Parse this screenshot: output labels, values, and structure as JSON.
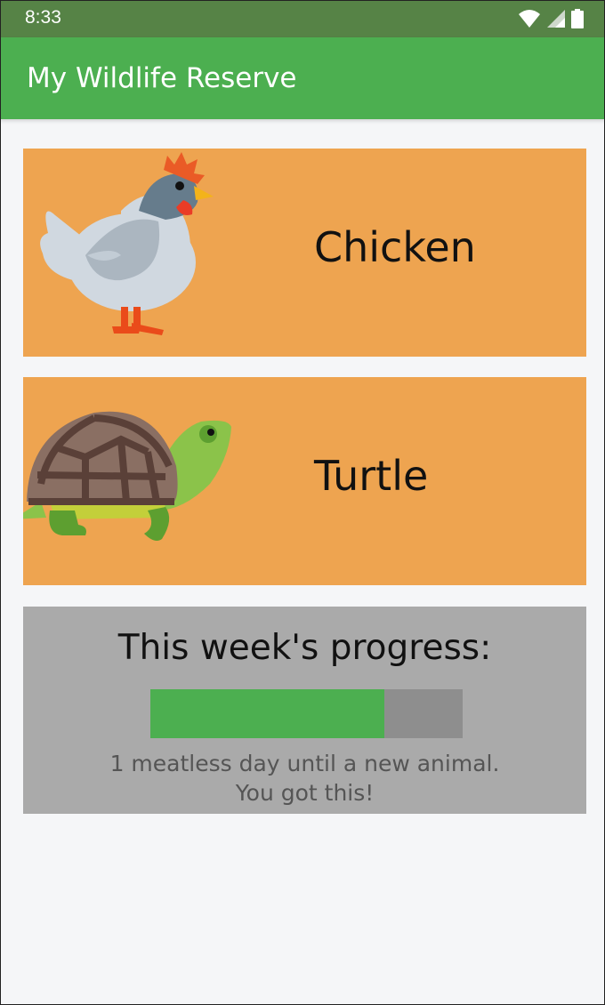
{
  "status_bar": {
    "time": "8:33",
    "icons": [
      "wifi-icon",
      "signal-icon",
      "battery-icon"
    ]
  },
  "app_bar": {
    "title": "My Wildlife Reserve",
    "color": "#4caf50"
  },
  "animals": [
    {
      "name": "Chicken",
      "icon": "chicken-icon",
      "card_color": "#eea450"
    },
    {
      "name": "Turtle",
      "icon": "turtle-icon",
      "card_color": "#eea450"
    }
  ],
  "progress": {
    "title": "This week's progress:",
    "fraction": 0.75,
    "message_line1": "1 meatless day until a new animal.",
    "message_line2": "You got this!",
    "fill_color": "#4caf50"
  }
}
